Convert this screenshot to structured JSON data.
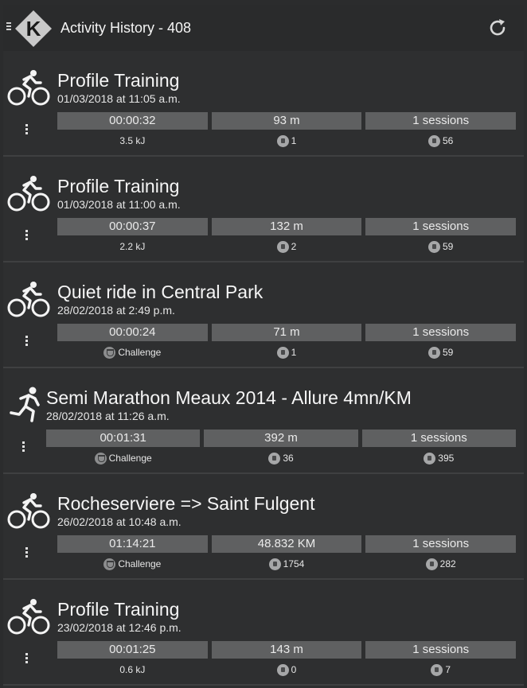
{
  "header": {
    "title": "Activity History - 408",
    "logo_letter": "K",
    "refresh_icon": "refresh-icon",
    "menu_icon": "drawer-icon"
  },
  "colors": {
    "background": "#2e2f30",
    "stat_box": "#5f6061",
    "text": "#f2f2f2"
  },
  "activities": [
    {
      "sport_icon": "cycling-icon",
      "title": "Profile Training",
      "date": "01/03/2018 at 11:05 a.m.",
      "duration": "00:00:32",
      "distance": "93 m",
      "sessions": "1 sessions",
      "extra": "3.5 kJ",
      "count_a": "1",
      "count_b": "56"
    },
    {
      "sport_icon": "cycling-icon",
      "title": "Profile Training",
      "date": "01/03/2018 at 11:00 a.m.",
      "duration": "00:00:37",
      "distance": "132 m",
      "sessions": "1 sessions",
      "extra": "2.2 kJ",
      "count_a": "2",
      "count_b": "59"
    },
    {
      "sport_icon": "cycling-icon",
      "title": "Quiet ride in Central Park",
      "date": "28/02/2018 at 2:49 p.m.",
      "duration": "00:00:24",
      "distance": "71 m",
      "sessions": "1 sessions",
      "extra": "Challenge",
      "count_a": "1",
      "count_b": "59"
    },
    {
      "sport_icon": "running-icon",
      "title": "Semi Marathon Meaux 2014 - Allure 4mn/KM",
      "date": "28/02/2018 at 11:26 a.m.",
      "duration": "00:01:31",
      "distance": "392 m",
      "sessions": "1 sessions",
      "extra": "Challenge",
      "count_a": "36",
      "count_b": "395"
    },
    {
      "sport_icon": "cycling-icon",
      "title": "Rocheserviere => Saint Fulgent",
      "date": "26/02/2018 at 10:48 a.m.",
      "duration": "01:14:21",
      "distance": "48.832 KM",
      "sessions": "1 sessions",
      "extra": "Challenge",
      "count_a": "1754",
      "count_b": "282"
    },
    {
      "sport_icon": "cycling-icon",
      "title": "Profile Training",
      "date": "23/02/2018 at 12:46 p.m.",
      "duration": "00:01:25",
      "distance": "143 m",
      "sessions": "1 sessions",
      "extra": "0.6 kJ",
      "count_a": "0",
      "count_b": "7"
    }
  ]
}
